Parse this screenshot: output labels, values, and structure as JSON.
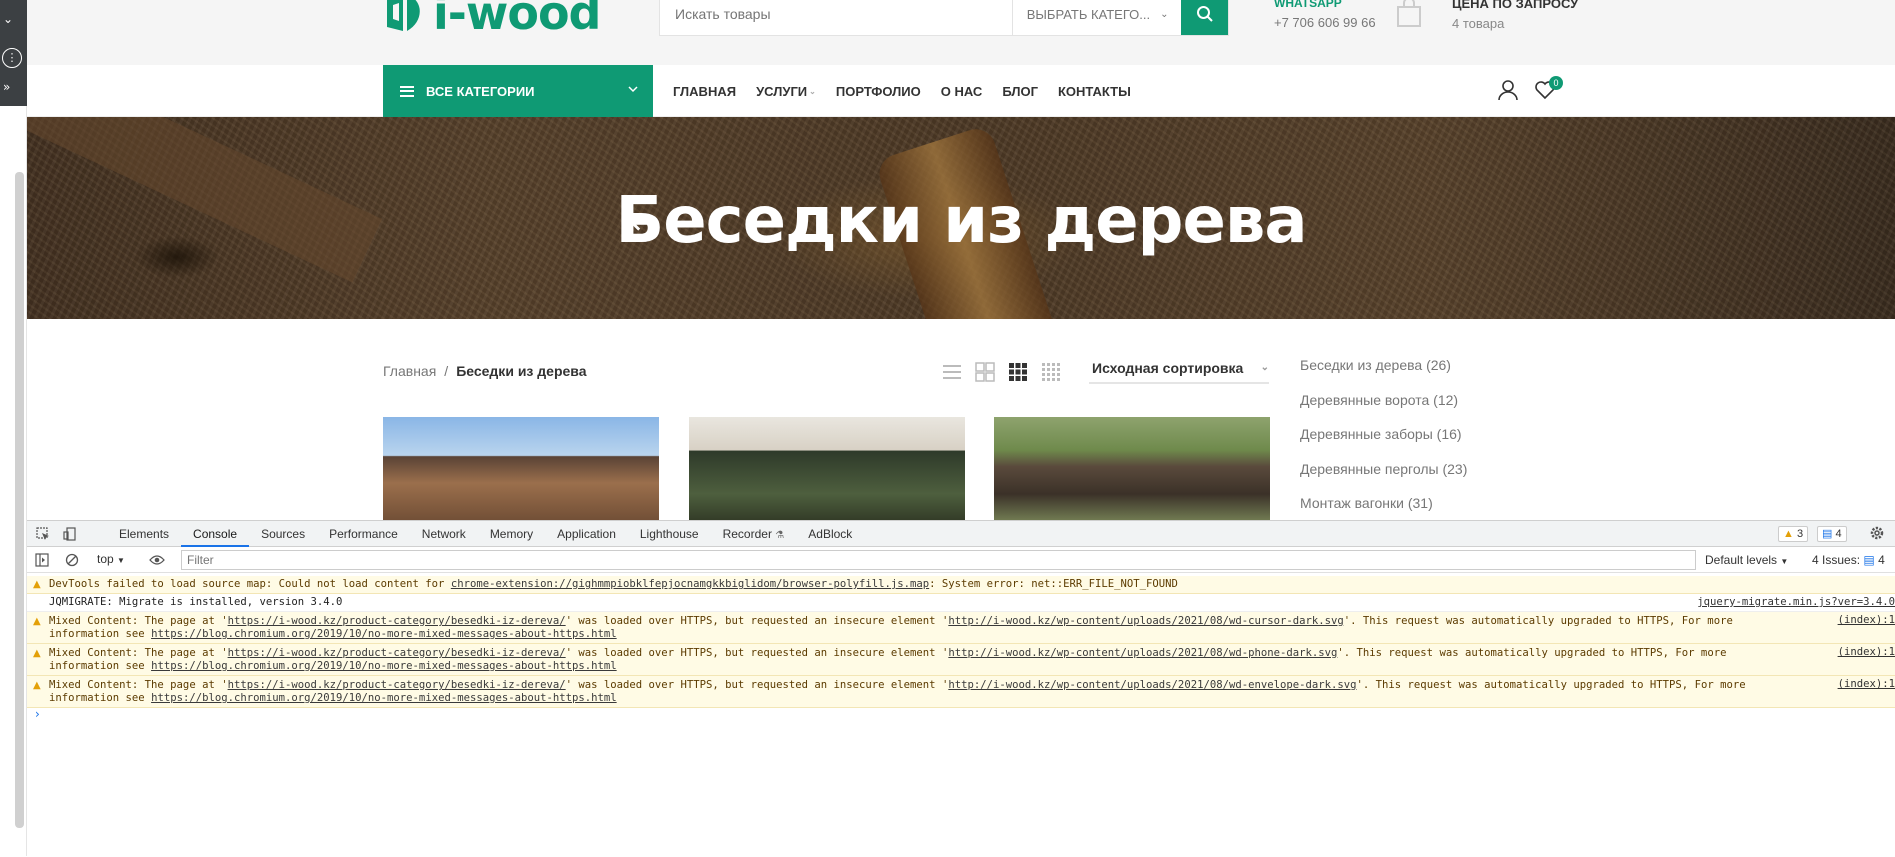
{
  "header": {
    "logo_text": "i-wood",
    "search_placeholder": "Искать товары",
    "category_select": "ВЫБРАТЬ КАТЕГО...",
    "whatsapp_label": "WHATSAPP",
    "phone": "+7 706 606 99 66",
    "price_label": "ЦЕНА ПО ЗАПРОСУ",
    "items_count": "4 товара"
  },
  "nav": {
    "all_categories": "ВСЕ КАТЕГОРИИ",
    "links": [
      "ГЛАВНАЯ",
      "УСЛУГИ",
      "ПОРТФОЛИО",
      "О НАС",
      "БЛОГ",
      "КОНТАКТЫ"
    ],
    "wishlist_count": "0"
  },
  "hero": {
    "title": "Беседки из дерева"
  },
  "breadcrumb": {
    "home": "Главная",
    "separator": "/",
    "current": "Беседки из дерева"
  },
  "sort": {
    "label": "Исходная сортировка"
  },
  "sidebar_categories": [
    "Беседки из дерева (26)",
    "Деревянные ворота (12)",
    "Деревянные заборы (16)",
    "Деревянные перголы (23)",
    "Монтаж вагонки (31)"
  ],
  "devtools": {
    "tabs": [
      "Elements",
      "Console",
      "Sources",
      "Performance",
      "Network",
      "Memory",
      "Application",
      "Lighthouse",
      "Recorder",
      "AdBlock"
    ],
    "active_tab": "Console",
    "warn_count": "3",
    "info_count": "4",
    "context": "top",
    "filter_placeholder": "Filter",
    "levels": "Default levels",
    "issues": "4 Issues:",
    "issues_count": "4",
    "messages": [
      {
        "type": "warning",
        "pre": "DevTools failed to load source map: Could not load content for ",
        "link": "chrome-extension://gighmmpiobklfepjocnamgkkbiglidom/browser-polyfill.js.map",
        "post": ": System error: net::ERR_FILE_NOT_FOUND",
        "source": ""
      },
      {
        "type": "info",
        "pre": "JQMIGRATE: Migrate is installed, version 3.4.0",
        "source": "jquery-migrate.min.js?ver=3.4.0"
      },
      {
        "type": "warning",
        "pre": "Mixed Content: The page at '",
        "link": "https://i-wood.kz/product-category/besedki-iz-dereva/",
        "mid": "' was loaded over HTTPS, but requested an insecure element '",
        "link2": "http://i-wood.kz/wp-content/uploads/2021/08/wd-cursor-dark.svg",
        "post": "'. This request was automatically upgraded to HTTPS, For more",
        "line2_pre": "information see ",
        "line2_link": "https://blog.chromium.org/2019/10/no-more-mixed-messages-about-https.html",
        "source": "(index):1"
      },
      {
        "type": "warning",
        "pre": "Mixed Content: The page at '",
        "link": "https://i-wood.kz/product-category/besedki-iz-dereva/",
        "mid": "' was loaded over HTTPS, but requested an insecure element '",
        "link2": "http://i-wood.kz/wp-content/uploads/2021/08/wd-phone-dark.svg",
        "post": "'. This request was automatically upgraded to HTTPS, For more",
        "line2_pre": "information see ",
        "line2_link": "https://blog.chromium.org/2019/10/no-more-mixed-messages-about-https.html",
        "source": "(index):1"
      },
      {
        "type": "warning",
        "pre": "Mixed Content: The page at '",
        "link": "https://i-wood.kz/product-category/besedki-iz-dereva/",
        "mid": "' was loaded over HTTPS, but requested an insecure element '",
        "link2": "http://i-wood.kz/wp-content/uploads/2021/08/wd-envelope-dark.svg",
        "post": "'. This request was automatically upgraded to HTTPS, For more",
        "line2_pre": "information see ",
        "line2_link": "https://blog.chromium.org/2019/10/no-more-mixed-messages-about-https.html",
        "source": "(index):1"
      }
    ]
  },
  "colors": {
    "brand": "#0f9a74",
    "warning_bg": "#fffbe5",
    "devtools_accent": "#1a73e8"
  },
  "icons": [
    "search-icon",
    "bag-icon",
    "user-icon",
    "heart-icon",
    "hamburger-icon",
    "chevron-down-icon",
    "list-view-icon",
    "grid-view-icon",
    "inspect-icon",
    "device-toolbar-icon",
    "gear-icon",
    "clear-console-icon",
    "eye-icon",
    "warning-icon"
  ]
}
